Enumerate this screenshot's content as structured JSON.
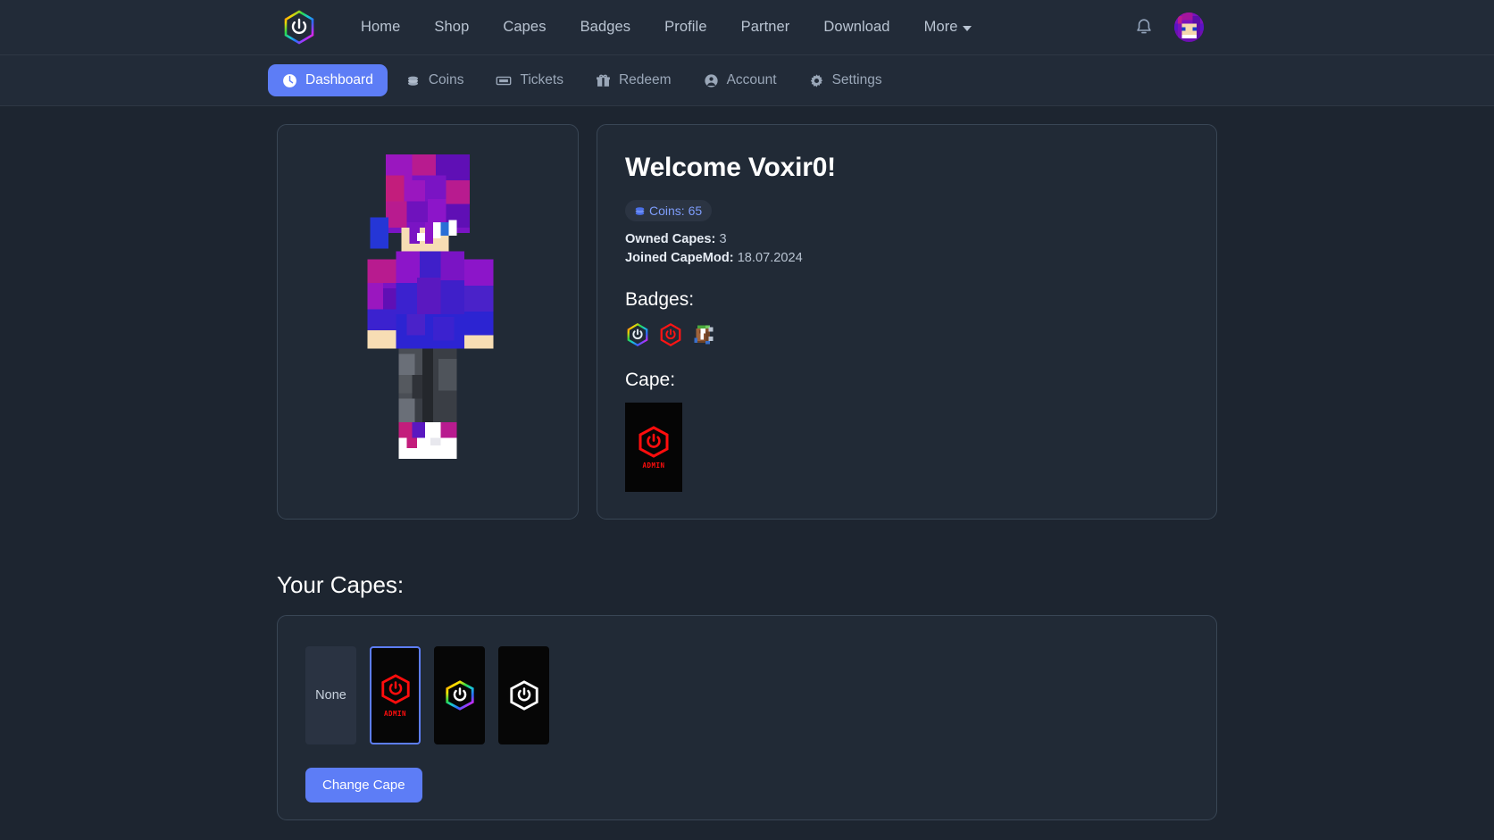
{
  "topnav": {
    "logo_icon": "hexagon-power-logo",
    "links": [
      {
        "label": "Home",
        "name": "nav-home"
      },
      {
        "label": "Shop",
        "name": "nav-shop"
      },
      {
        "label": "Capes",
        "name": "nav-capes"
      },
      {
        "label": "Badges",
        "name": "nav-badges"
      },
      {
        "label": "Profile",
        "name": "nav-profile"
      },
      {
        "label": "Partner",
        "name": "nav-partner"
      },
      {
        "label": "Download",
        "name": "nav-download"
      },
      {
        "label": "More",
        "name": "nav-more"
      }
    ],
    "notifications_icon": "bell-icon",
    "avatar_icon": "user-avatar"
  },
  "subnav": {
    "items": [
      {
        "label": "Dashboard",
        "icon": "dashboard-icon",
        "active": true
      },
      {
        "label": "Coins",
        "icon": "coins-icon",
        "active": false
      },
      {
        "label": "Tickets",
        "icon": "ticket-icon",
        "active": false
      },
      {
        "label": "Redeem",
        "icon": "gift-icon",
        "active": false
      },
      {
        "label": "Account",
        "icon": "account-circle-icon",
        "active": false
      },
      {
        "label": "Settings",
        "icon": "gear-icon",
        "active": false
      }
    ]
  },
  "profile": {
    "welcome": "Welcome Voxir0!",
    "coins_label": "Coins: 65",
    "coins_value": 65,
    "owned_capes_label": "Owned Capes:",
    "owned_capes_value": "3",
    "joined_label": "Joined CapeMod:",
    "joined_value": "18.07.2024",
    "badges_title": "Badges:",
    "badges": [
      {
        "name": "rainbow-hexagon-badge",
        "type": "hex",
        "stroke": "rainbow"
      },
      {
        "name": "red-hexagon-badge",
        "type": "hex",
        "stroke": "#ff1414"
      },
      {
        "name": "pixel-item-badge",
        "type": "pixel"
      }
    ],
    "cape_title": "Cape:",
    "current_cape": {
      "name": "admin-cape",
      "label": "ADMIN",
      "color": "#ff0d0d"
    }
  },
  "your_capes": {
    "title": "Your Capes:",
    "options": [
      {
        "id": "none",
        "label": "None",
        "selected": false,
        "style": "none"
      },
      {
        "id": "admin",
        "label": "ADMIN",
        "selected": true,
        "style": "red"
      },
      {
        "id": "rainbow",
        "label": "",
        "selected": false,
        "style": "rainbow"
      },
      {
        "id": "white",
        "label": "",
        "selected": false,
        "style": "white"
      }
    ],
    "change_button": "Change Cape"
  },
  "colors": {
    "page_bg": "#1d2530",
    "nav_bg": "#222b38",
    "card_bg": "#212a36",
    "card_border": "#394655",
    "accent": "#5d7df6",
    "admin_red": "#ff0d0d",
    "muted_text": "#b9c4d2"
  }
}
